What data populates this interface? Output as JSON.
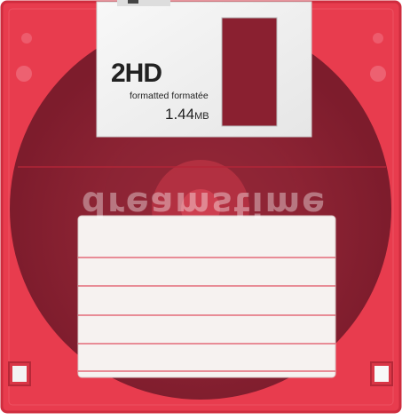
{
  "disk": {
    "density": "2HD",
    "format_text": "formatted formatée",
    "capacity_number": "1.44",
    "capacity_unit": "MB"
  },
  "watermark": {
    "text": "dreamstime"
  },
  "colors": {
    "body": "#e83c4e",
    "body_edge": "#d42a3c",
    "disc": "#7a1e2e",
    "shutter": "#f4f4f4",
    "label": "#f6f2f0",
    "label_lines": "#e05060"
  }
}
